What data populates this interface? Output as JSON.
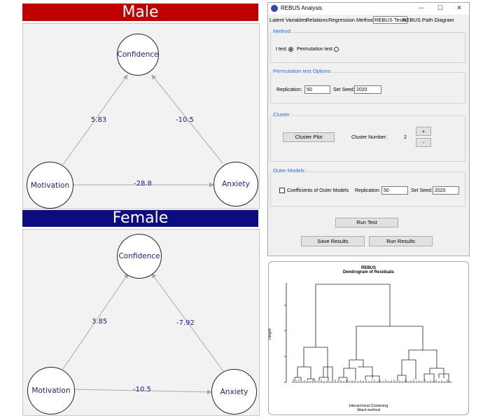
{
  "male": {
    "title": "Male",
    "nodes": {
      "confidence": "Confidence",
      "motivation": "Motivation",
      "anxiety": "Anxiety"
    },
    "coef": {
      "motivation_confidence": "5.83",
      "anxiety_confidence": "-10.5",
      "motivation_anxiety": "-28.8"
    }
  },
  "female": {
    "title": "Female",
    "nodes": {
      "confidence": "Confidence",
      "motivation": "Motivation",
      "anxiety": "Anxiety"
    },
    "coef": {
      "motivation_confidence": "3.85",
      "anxiety_confidence": "-7.92",
      "motivation_anxiety": "-10.5"
    }
  },
  "window": {
    "title": "REBUS Analysis",
    "controls": {
      "minimize": "─",
      "maximize": "☐",
      "close": "✕"
    },
    "tabs": [
      "Latent Variables",
      "Relations",
      "Regression Methods",
      "REBUS Tests",
      "REBUS Path Diagram"
    ],
    "active_tab": "REBUS Tests",
    "method": {
      "title": "Method",
      "ttest": "t test",
      "perm": "Permutation test",
      "selected": "t test"
    },
    "perm_options": {
      "title": "Permutation test Options",
      "replication_label": "Replication:",
      "replication": "50",
      "seed_label": "Set Seed:",
      "seed": "2020"
    },
    "cluster": {
      "title": "Cluster",
      "plot_button": "Cluster Plot",
      "number_label": "Cluster Number:",
      "number": "2",
      "plus": "+",
      "minus": "-"
    },
    "outer": {
      "title": "Outer Models",
      "coef_label": "Coefficients of Outer Models",
      "replication_label": "Replication:",
      "replication": "50",
      "seed_label": "Set Seed:",
      "seed": "2020"
    },
    "run_test": "Run Test",
    "save_results": "Save Results",
    "run_results": "Run Results"
  },
  "dendrogram": {
    "title": "REBUS",
    "subtitle": "Dendrogram of Residuals",
    "ylabel": "Height",
    "xlabel": "Hierarchical Clustering",
    "xsub": "Ward method"
  }
}
